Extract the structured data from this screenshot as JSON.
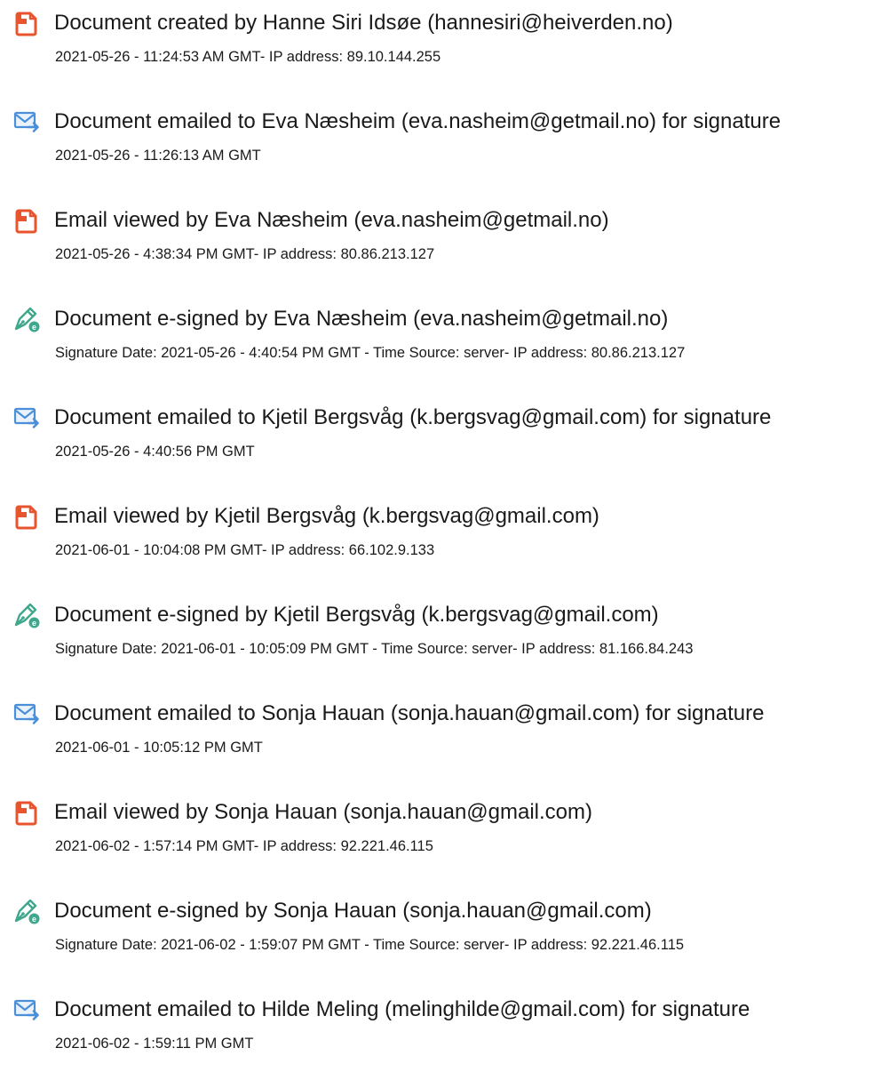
{
  "events": [
    {
      "icon": "document-created-icon",
      "title": "Document created by Hanne Siri Idsøe (hannesiri@heiverden.no)",
      "detail": "2021-05-26 - 11:24:53 AM GMT- IP address: 89.10.144.255"
    },
    {
      "icon": "email-sent-icon",
      "title": "Document emailed to Eva Næsheim (eva.nasheim@getmail.no) for signature",
      "detail": "2021-05-26 - 11:26:13 AM GMT"
    },
    {
      "icon": "document-created-icon",
      "title": "Email viewed by Eva Næsheim (eva.nasheim@getmail.no)",
      "detail": "2021-05-26 - 4:38:34 PM GMT- IP address: 80.86.213.127"
    },
    {
      "icon": "e-signed-pen-icon",
      "title": "Document e-signed by Eva Næsheim (eva.nasheim@getmail.no)",
      "detail": "Signature Date: 2021-05-26 - 4:40:54 PM GMT - Time Source: server- IP address: 80.86.213.127"
    },
    {
      "icon": "email-sent-icon",
      "title": "Document emailed to Kjetil Bergsvåg (k.bergsvag@gmail.com) for signature",
      "detail": "2021-05-26 - 4:40:56 PM GMT"
    },
    {
      "icon": "document-created-icon",
      "title": "Email viewed by Kjetil Bergsvåg (k.bergsvag@gmail.com)",
      "detail": "2021-06-01 - 10:04:08 PM GMT- IP address: 66.102.9.133"
    },
    {
      "icon": "e-signed-pen-icon",
      "title": "Document e-signed by Kjetil Bergsvåg (k.bergsvag@gmail.com)",
      "detail": "Signature Date: 2021-06-01 - 10:05:09 PM GMT - Time Source: server- IP address: 81.166.84.243"
    },
    {
      "icon": "email-sent-icon",
      "title": "Document emailed to Sonja Hauan (sonja.hauan@gmail.com) for signature",
      "detail": "2021-06-01 - 10:05:12 PM GMT"
    },
    {
      "icon": "document-created-icon",
      "title": "Email viewed by Sonja Hauan (sonja.hauan@gmail.com)",
      "detail": "2021-06-02 - 1:57:14 PM GMT- IP address: 92.221.46.115"
    },
    {
      "icon": "e-signed-pen-icon",
      "title": "Document e-signed by Sonja Hauan (sonja.hauan@gmail.com)",
      "detail": "Signature Date: 2021-06-02 - 1:59:07 PM GMT - Time Source: server- IP address: 92.221.46.115"
    },
    {
      "icon": "email-sent-icon",
      "title": "Document emailed to Hilde Meling (melinghilde@gmail.com) for signature",
      "detail": "2021-06-02 - 1:59:11 PM GMT"
    }
  ],
  "colors": {
    "document_icon": "#e8542e",
    "email_icon": "#4a8fd8",
    "pen_icon": "#3fa78c",
    "text": "#1a1a1a"
  }
}
